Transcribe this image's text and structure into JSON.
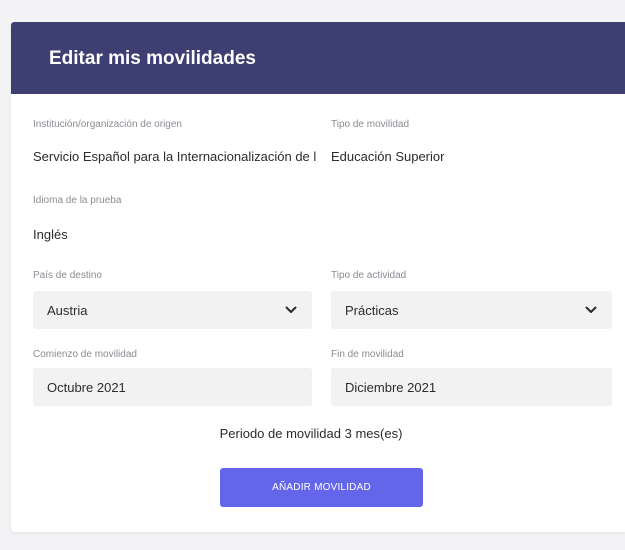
{
  "card": {
    "title": "Editar mis movilidades",
    "header_color": "#3d3e72"
  },
  "form": {
    "institution": {
      "label": "Institución/organización de origen",
      "value": "Servicio Español para la Internacionalización de l"
    },
    "mobility_type": {
      "label": "Tipo de movilidad",
      "value": "Educación Superior"
    },
    "test_language": {
      "label": "Idioma de la prueba",
      "value": "Inglés"
    },
    "destination_country": {
      "label": "País de destino",
      "value": "Austria",
      "icon": "chevron-down-icon"
    },
    "activity_type": {
      "label": "Tipo de actividad",
      "value": "Prácticas",
      "icon": "chevron-down-icon"
    },
    "start": {
      "label": "Comienzo de movilidad",
      "value": "Octubre 2021"
    },
    "end": {
      "label": "Fin de movilidad",
      "value": "Diciembre 2021"
    },
    "period_text": "Periodo de movilidad 3 mes(es)"
  },
  "actions": {
    "add_label": "AÑADIR MOVILIDAD",
    "add_color": "#6366e8"
  }
}
